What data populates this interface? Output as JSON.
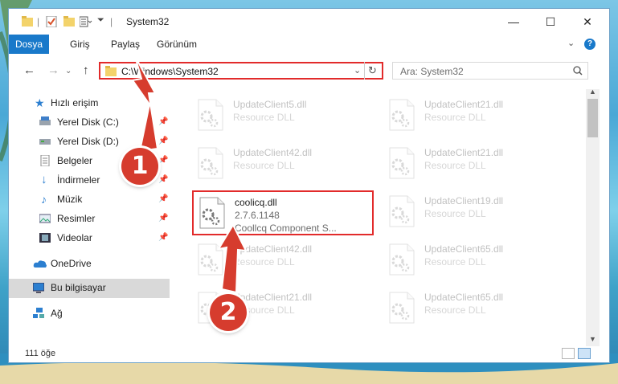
{
  "window": {
    "title": "System32",
    "controls": {
      "minimize": "—",
      "maximize": "☐",
      "close": "✕"
    }
  },
  "ribbon": {
    "tabs": [
      "Dosya",
      "Giriş",
      "Paylaş",
      "Görünüm"
    ],
    "active_tab": "Dosya"
  },
  "address": {
    "path": "C:\\Windows\\System32",
    "search_placeholder": "Ara: System32"
  },
  "sidebar": {
    "items": [
      {
        "label": "Hızlı erişim",
        "icon": "star-icon",
        "pinned": false
      },
      {
        "label": "Yerel Disk (C:)",
        "icon": "drive-icon",
        "pinned": true
      },
      {
        "label": "Yerel Disk (D:)",
        "icon": "drive-icon",
        "pinned": true
      },
      {
        "label": "Belgeler",
        "icon": "documents-icon",
        "pinned": true
      },
      {
        "label": "İndirmeler",
        "icon": "download-icon",
        "pinned": true
      },
      {
        "label": "Müzik",
        "icon": "music-icon",
        "pinned": true
      },
      {
        "label": "Resimler",
        "icon": "pictures-icon",
        "pinned": true
      },
      {
        "label": "Videolar",
        "icon": "video-icon",
        "pinned": true
      },
      {
        "label": "OneDrive",
        "icon": "cloud-icon",
        "pinned": false
      },
      {
        "label": "Bu bilgisayar",
        "icon": "computer-icon",
        "pinned": false,
        "selected": true
      },
      {
        "label": "Ağ",
        "icon": "network-icon",
        "pinned": false
      }
    ],
    "pin_glyph": "📌"
  },
  "files": [
    {
      "name": "UpdateClient5.dll",
      "desc": "Resource DLL"
    },
    {
      "name": "UpdateClient21.dll",
      "desc": "Resource DLL"
    },
    {
      "name": "UpdateClient42.dll",
      "desc": "Resource DLL"
    },
    {
      "name": "UpdateClient21.dll",
      "desc": "Resource DLL"
    },
    {
      "name": "coolicq.dll",
      "version": "2.7.6.1148",
      "desc": "Coollcq Component S...",
      "highlighted": true
    },
    {
      "name": "UpdateClient19.dll",
      "desc": "Resource DLL"
    },
    {
      "name": "UpdateClient42.dll",
      "desc": "Resource DLL"
    },
    {
      "name": "UpdateClient65.dll",
      "desc": "Resource DLL"
    },
    {
      "name": "UpdateClient21.dll",
      "desc": "Resource DLL"
    },
    {
      "name": "UpdateClient65.dll",
      "desc": "Resource DLL"
    }
  ],
  "status": {
    "item_count": "111 öğe"
  },
  "annotations": {
    "step1": "1",
    "step2": "2"
  },
  "colors": {
    "accent": "#1979ca",
    "highlight": "#e22b2b",
    "badge": "#d63c2e"
  }
}
